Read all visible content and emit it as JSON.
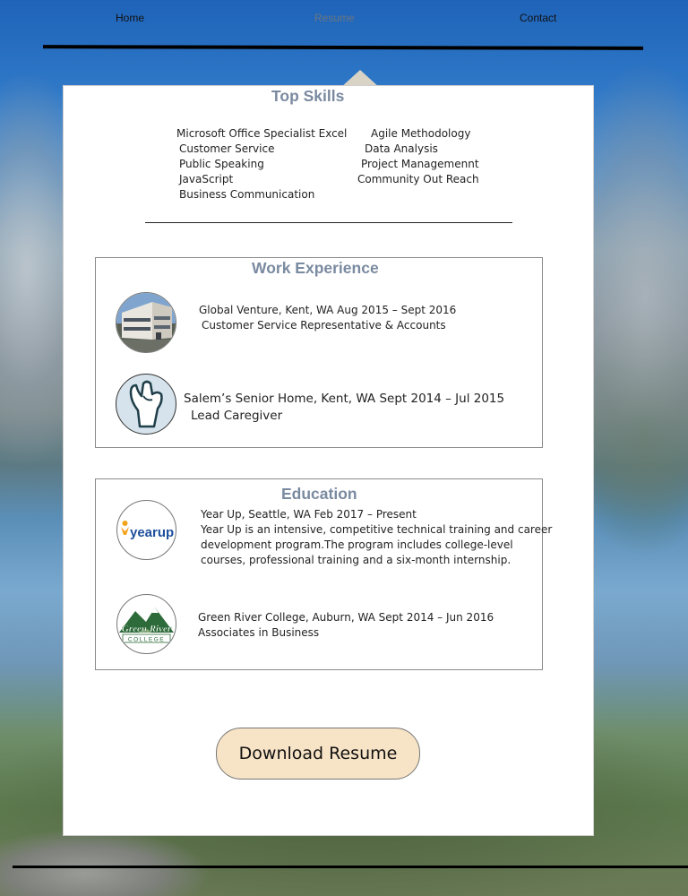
{
  "nav": {
    "home": "Home",
    "resume": "Resume",
    "contact": "Contact"
  },
  "skills": {
    "title": "Top Skills",
    "left": [
      "Microsoft Office Specialist Excel",
      "Customer Service",
      "Public Speaking",
      "JavaScript",
      "Business Communication"
    ],
    "right": [
      "Agile Methodology",
      "Data Analysis",
      "Project Managemennt",
      "Community Out Reach"
    ]
  },
  "work": {
    "title": "Work Experience",
    "jobs": [
      {
        "line1": "Global Venture, Kent, WA     Aug 2015 – Sept 2016",
        "line2": "Customer Service Representative & Accounts",
        "logo": "office-building-logo"
      },
      {
        "line1": "Salem’s Senior Home, Kent, WA   Sept 2014 – Jul 2015",
        "line2": "Lead Caregiver",
        "logo": "caring-hand-logo"
      }
    ]
  },
  "education": {
    "title": "Education",
    "schools": [
      {
        "line1": "Year Up, Seattle, WA               Feb 2017 – Present",
        "desc": [
          "Year Up is an intensive, competitive technical training and career",
          "development program.The program includes college-level",
          "courses, professional training and a six-month internship."
        ],
        "logo_text": "yearup"
      },
      {
        "line1": "Green River College, Auburn, WA          Sept 2014 – Jun 2016",
        "desc": [
          "Associates in Business"
        ],
        "logo_text_top": "Green River",
        "logo_text_bottom": "COLLEGE"
      }
    ]
  },
  "download_button": "Download Resume",
  "colors": {
    "section_title": "#7a8aa0",
    "button_bg": "#f7e3c6",
    "yearup_orange": "#f2a31a",
    "yearup_blue": "#1d4f9c",
    "greenriver_green": "#2e6b3a"
  }
}
